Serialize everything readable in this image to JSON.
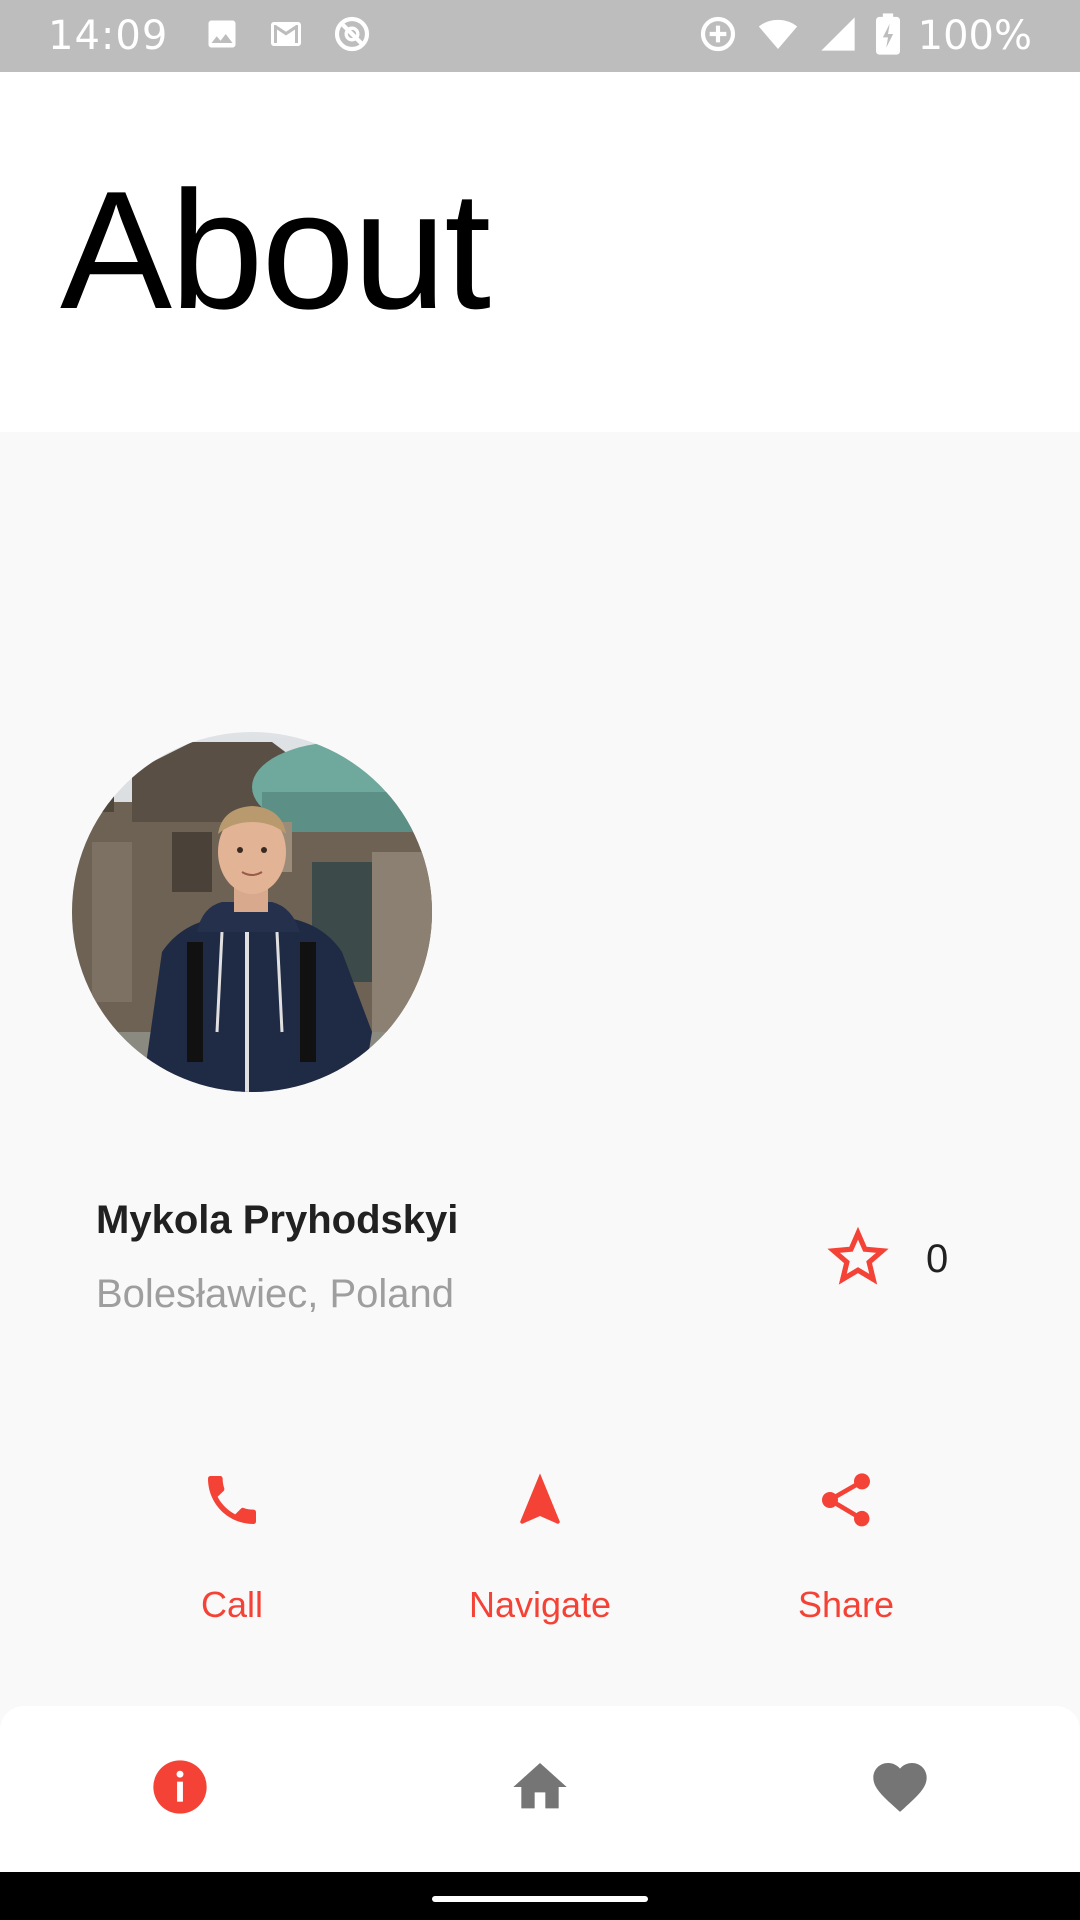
{
  "status_bar": {
    "time": "14:09",
    "battery": "100%",
    "icons": [
      "image-icon",
      "gmail-icon",
      "do-not-disturb-icon",
      "data-saver-icon",
      "wifi-icon",
      "signal-icon",
      "battery-charging-icon"
    ]
  },
  "header": {
    "title": "About"
  },
  "profile": {
    "name": "Mykola Pryhodskyi",
    "location": "Bolesławiec, Poland",
    "rating_count": "0"
  },
  "actions": [
    {
      "label": "Call",
      "icon": "phone-icon"
    },
    {
      "label": "Navigate",
      "icon": "navigation-arrow-icon"
    },
    {
      "label": "Share",
      "icon": "share-icon"
    }
  ],
  "bottom_nav": {
    "items": [
      {
        "name": "info",
        "icon": "info-icon",
        "active": true
      },
      {
        "name": "home",
        "icon": "home-icon",
        "active": false
      },
      {
        "name": "favorites",
        "icon": "heart-icon",
        "active": false
      }
    ]
  },
  "colors": {
    "accent": "#f44336",
    "status_bar": "#bdbdbd",
    "inactive_icon": "#757575",
    "background": "#f9f9f9"
  }
}
